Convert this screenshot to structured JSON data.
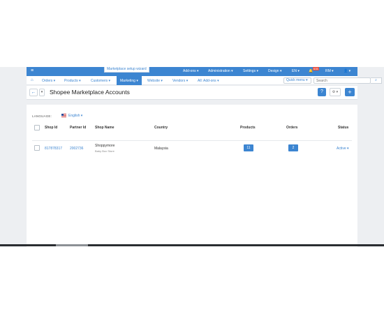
{
  "topbar": {
    "tooltip": "Marketplace setup wizard",
    "menu": [
      "Add-ons ▾",
      "Administration ▾",
      "Settings ▾",
      "Design ▾",
      "EN ▾",
      "RM ▾"
    ],
    "notification_count": "635"
  },
  "nav": {
    "items": [
      "Orders ▾",
      "Products ▾",
      "Customers ▾",
      "Marketing ▾",
      "Website ▾",
      "Vendors ▾",
      "All: Add-ons ▾"
    ],
    "active_item": "Marketing",
    "quick_menu": "Quick menu ▾",
    "search_placeholder": "Search"
  },
  "page": {
    "title": "Shopee Marketplace Accounts"
  },
  "language": {
    "label": "LANGUAGE:",
    "value": "English ▾"
  },
  "table": {
    "headers": [
      "Shop Id",
      "Partner Id",
      "Shop Name",
      "Country",
      "Products",
      "Orders",
      "Status"
    ],
    "rows": [
      {
        "shop_id": "817878317",
        "partner_id": "2002736",
        "shop_name": "Shoppymore",
        "shop_subtitle": "Baby Box Store",
        "country": "Malaysia",
        "products": "11",
        "orders": "2",
        "status": "Active ▾"
      }
    ]
  },
  "colors": {
    "primary": "#3c85d1",
    "badge": "#e74c3c",
    "background": "#edeff2"
  }
}
